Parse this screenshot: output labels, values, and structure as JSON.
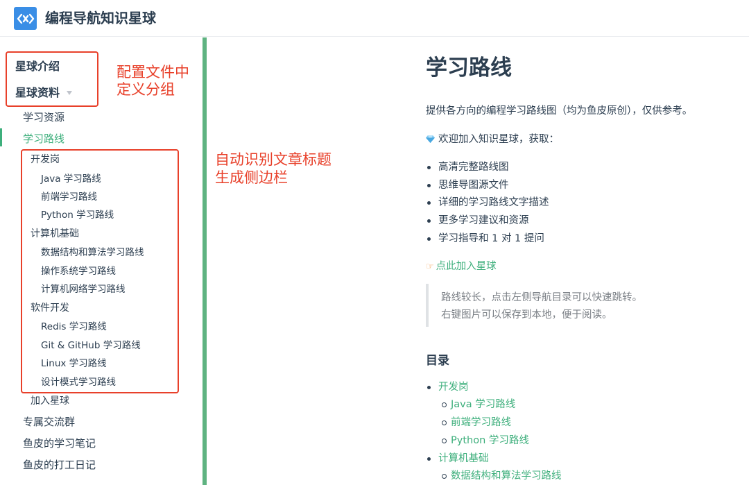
{
  "navbar": {
    "title": "编程导航知识星球"
  },
  "sidebar": {
    "groups": [
      "星球介绍",
      "星球资料"
    ],
    "items": [
      {
        "label": "学习资源"
      },
      {
        "label": "学习路线"
      },
      {
        "label": "开发岗"
      },
      {
        "label": "Java 学习路线"
      },
      {
        "label": "前端学习路线"
      },
      {
        "label": "Python 学习路线"
      },
      {
        "label": "计算机基础"
      },
      {
        "label": "数据结构和算法学习路线"
      },
      {
        "label": "操作系统学习路线"
      },
      {
        "label": "计算机网络学习路线"
      },
      {
        "label": "软件开发"
      },
      {
        "label": "Redis 学习路线"
      },
      {
        "label": "Git & GitHub 学习路线"
      },
      {
        "label": "Linux 学习路线"
      },
      {
        "label": "设计模式学习路线"
      },
      {
        "label": "加入星球"
      },
      {
        "label": "专属交流群"
      },
      {
        "label": "鱼皮的学习笔记"
      },
      {
        "label": "鱼皮的打工日记"
      }
    ],
    "active_item": "学习路线"
  },
  "annotations": {
    "groups_note": [
      "配置文件中",
      "定义分组"
    ],
    "headings_note": [
      "自动识别文章标题",
      "生成侧边栏"
    ],
    "color": "#e8402a"
  },
  "content": {
    "title": "学习路线",
    "intro": "提供各方向的编程学习路线图（均为鱼皮原创），仅供参考。",
    "welcome": "欢迎加入知识星球，获取：",
    "benefits": [
      "高清完整路线图",
      "思维导图源文件",
      "详细的学习路线文字描述",
      "更多学习建议和资源",
      "学习指导和 1 对 1 提问"
    ],
    "join_link": "点此加入星球",
    "quote": [
      "路线较长，点击左侧导航目录可以快速跳转。",
      "右键图片可以保存到本地，便于阅读。"
    ],
    "toc_title": "目录",
    "toc": [
      {
        "label": "开发岗",
        "children": [
          "Java 学习路线",
          "前端学习路线",
          "Python 学习路线"
        ]
      },
      {
        "label": "计算机基础",
        "children": [
          "数据结构和算法学习路线"
        ]
      }
    ]
  },
  "colors": {
    "accent": "#3eaf7c",
    "text": "#2c3e50",
    "logo": "#3a8ee6",
    "divider": "#5fb381"
  },
  "icons": [
    "logo-icon",
    "caret-down-icon",
    "gem-icon",
    "pointing-hand-icon"
  ]
}
